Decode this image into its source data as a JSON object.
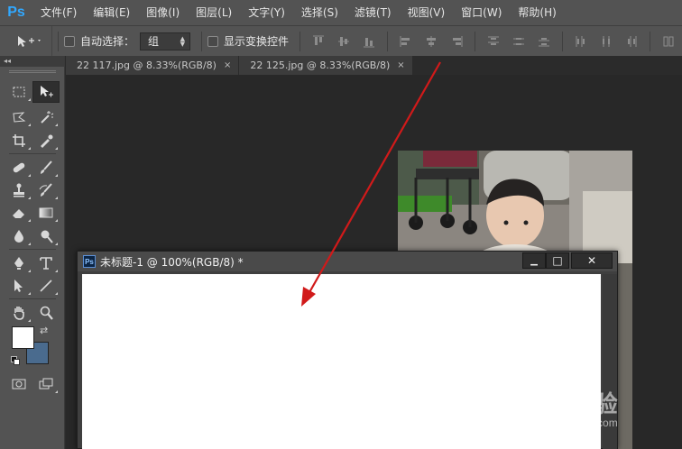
{
  "app": {
    "logo": "Ps",
    "menu": [
      "文件(F)",
      "编辑(E)",
      "图像(I)",
      "图层(L)",
      "文字(Y)",
      "选择(S)",
      "滤镜(T)",
      "视图(V)",
      "窗口(W)",
      "帮助(H)"
    ]
  },
  "options": {
    "auto_select_label": "自动选择：",
    "auto_select_value": "组",
    "show_transform_label": "显示变换控件"
  },
  "tabs": [
    {
      "label": "22 117.jpg @ 8.33%(RGB/8)",
      "close": "×"
    },
    {
      "label": "22 125.jpg @ 8.33%(RGB/8)",
      "close": "×"
    }
  ],
  "toolbox": {
    "collapse": "◂◂",
    "swap_glyph": "⇄"
  },
  "colors": {
    "foreground": "#ffffff",
    "background": "#4a6b8e",
    "annotation_arrow": "#d11a1a"
  },
  "floating_window": {
    "icon_text": "Ps",
    "title": "未标题-1 @ 100%(RGB/8) *",
    "min_glyph": "▁",
    "max_glyph": "□",
    "close_glyph": "✕"
  },
  "watermark": {
    "brand": "Bai 经验",
    "sub": "jingyan.baidu.com"
  }
}
